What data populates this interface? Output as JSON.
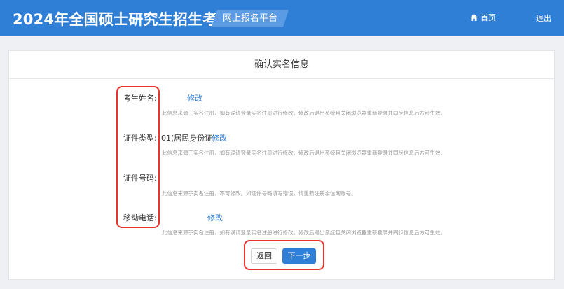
{
  "header": {
    "title": "2024年全国硕士研究生招生考试",
    "platform": "网上报名平台",
    "home_label": "首页",
    "logout_label": "退出"
  },
  "card": {
    "title": "确认实名信息",
    "fields": [
      {
        "label": "考生姓名:",
        "value": "",
        "edit_label": "修改",
        "hint": "此信息来源于实名注册，如有误请登录实名注册进行修改。修改后退出系统且关闭浏览器重新登录并同步信息后方可生效。"
      },
      {
        "label": "证件类型:",
        "value": "01(居民身份证)",
        "edit_label": "修改",
        "hint": "此信息来源于实名注册，如有误请登录实名注册进行修改。修改后退出系统且关闭浏览器重新登录并同步信息后方可生效。"
      },
      {
        "label": "证件号码:",
        "value": "",
        "hint": "此信息来源于实名注册，不可修改。如证件号码填写错误，请重新注册学信网账号。"
      },
      {
        "label": "移动电话:",
        "value": "",
        "edit_label": "修改",
        "hint": "此信息来源于实名注册，如有误请登录实名注册进行修改。修改后退出系统且关闭浏览器重新登录并同步信息后方可生效。"
      }
    ]
  },
  "actions": {
    "back_label": "返回",
    "next_label": "下一步"
  },
  "colors": {
    "brand": "#2f7fd7",
    "highlight": "#e8352b"
  }
}
